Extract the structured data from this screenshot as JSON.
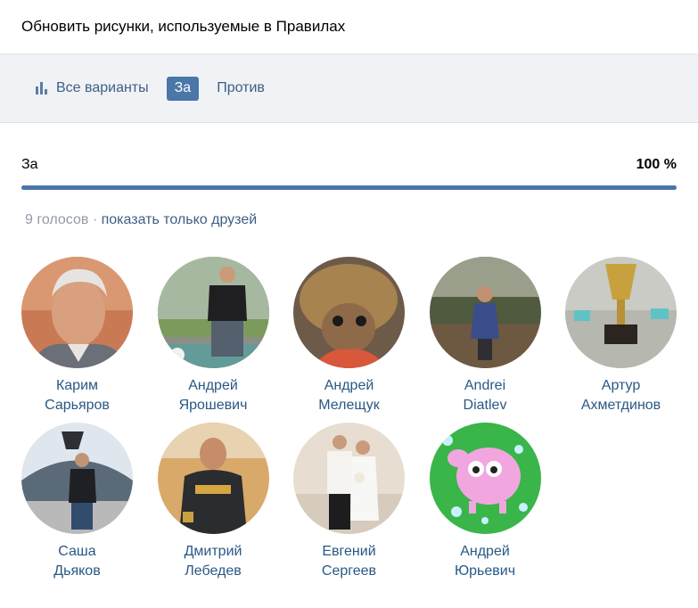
{
  "header": {
    "title": "Обновить рисунки, используемые в Правилах"
  },
  "tabs": [
    {
      "label": "Все варианты",
      "icon": "bar-chart-icon",
      "active": false
    },
    {
      "label": "За",
      "active": true
    },
    {
      "label": "Против",
      "active": false
    }
  ],
  "result": {
    "label": "За",
    "percent": "100 %",
    "fill": 1.0
  },
  "votes": {
    "count": "9 голосов",
    "separator": "·",
    "friends_link": "показать только друзей"
  },
  "voters": [
    {
      "first": "Карим",
      "last": "Сарьяров"
    },
    {
      "first": "Андрей",
      "last": "Ярошевич"
    },
    {
      "first": "Андрей",
      "last": "Мелещук"
    },
    {
      "first": "Andrei",
      "last": "Diatlev"
    },
    {
      "first": "Артур",
      "last": "Ахметдинов"
    },
    {
      "first": "Саша",
      "last": "Дьяков"
    },
    {
      "first": "Дмитрий",
      "last": "Лебедев"
    },
    {
      "first": "Евгений",
      "last": "Сергеев"
    },
    {
      "first": "Андрей",
      "last": "Юрьевич"
    }
  ],
  "colors": {
    "accent": "#4a76a8",
    "link": "#2a5885",
    "muted": "#939aa5"
  }
}
